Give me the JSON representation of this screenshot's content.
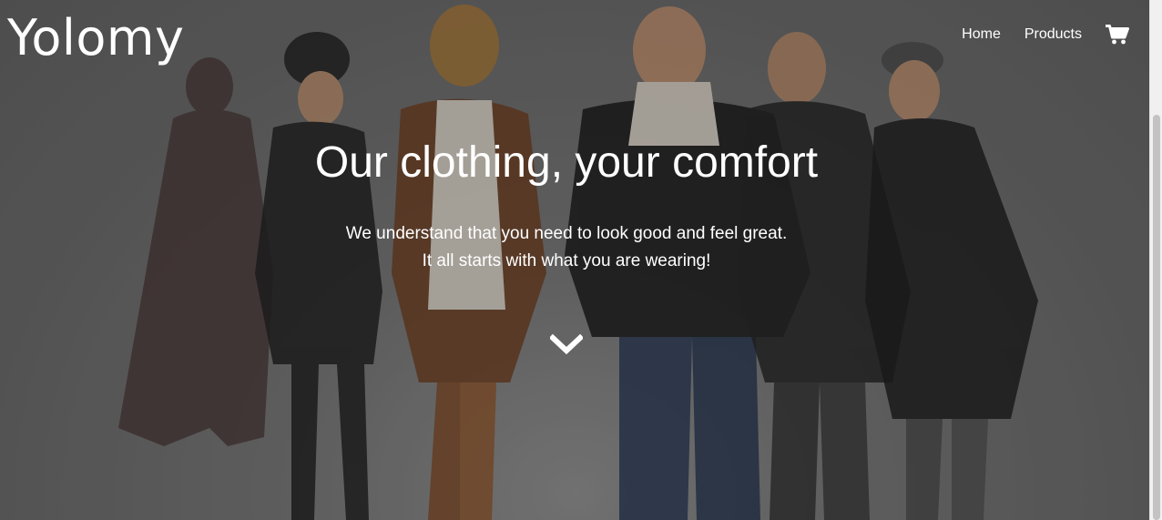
{
  "header": {
    "brand": "Yolomy",
    "nav": [
      {
        "label": "Home"
      },
      {
        "label": "Products"
      }
    ],
    "cart_icon": "shopping-cart-icon"
  },
  "hero": {
    "title": "Our clothing, your comfort",
    "subtitle_line1": "We understand that you need to look good and feel great.",
    "subtitle_line2": "It all starts with what you are wearing!",
    "scroll_icon": "chevron-down-icon",
    "background_image": "group of models in winter coats"
  },
  "colors": {
    "text": "#ffffff",
    "background": "#6a6a6a",
    "scrollbar_track": "#f0f0f0",
    "scrollbar_thumb": "#c3c3c3"
  }
}
